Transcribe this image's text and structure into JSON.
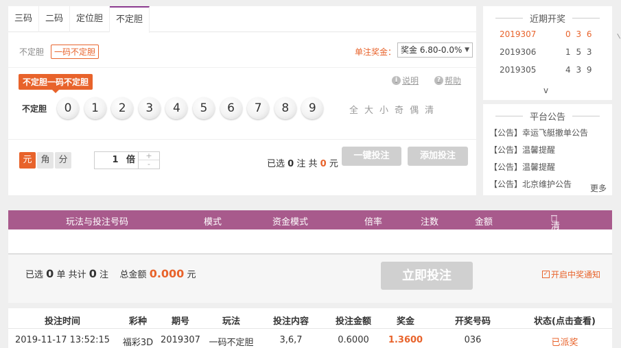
{
  "tabs": [
    "三码",
    "二码",
    "定位胆",
    "不定胆"
  ],
  "sub": {
    "plain": "不定胆",
    "active": "一码不定胆"
  },
  "prize": {
    "label": "单注奖金：",
    "select": "奖金 6.80-0.0%"
  },
  "badge": "不定胆一码不定胆",
  "help": {
    "explain": "说明",
    "help": "帮助"
  },
  "row_label": "不定胆",
  "balls": [
    "0",
    "1",
    "2",
    "3",
    "4",
    "5",
    "6",
    "7",
    "8",
    "9"
  ],
  "filters": [
    "全",
    "大",
    "小",
    "奇",
    "偶",
    "清"
  ],
  "units": [
    "元",
    "角",
    "分"
  ],
  "multiplier": {
    "value": "1",
    "unit": "倍",
    "plus": "+",
    "minus": "-"
  },
  "selection": {
    "prefix": "已选",
    "count": "0",
    "mid": "注 共",
    "amount": "0",
    "suffix": "元"
  },
  "buttons": {
    "one_click": "一键投注",
    "add": "添加投注",
    "submit": "立即投注"
  },
  "recent": {
    "title": "近期开奖",
    "draws": [
      {
        "issue": "2019307",
        "nums": "0 3 6"
      },
      {
        "issue": "2019306",
        "nums": "1 5 3"
      },
      {
        "issue": "2019305",
        "nums": "4 3 9"
      }
    ],
    "expand": "v"
  },
  "notices": {
    "title": "平台公告",
    "items": [
      "【公告】幸运飞艇撤单公告",
      "【公告】温馨提醒",
      "【公告】温馨提醒",
      "【公告】北京维护公告"
    ],
    "more": "更多"
  },
  "bet_table": {
    "headers": [
      "玩法与投注号码",
      "模式",
      "资金模式",
      "倍率",
      "注数",
      "金额",
      "清空"
    ]
  },
  "summary": {
    "p1": "已选",
    "orders": "0",
    "p2": "单 共计",
    "bets": "0",
    "p3": "注",
    "p4": "总金额",
    "total": "0.000",
    "p5": "元",
    "notify": "开启中奖通知"
  },
  "history": {
    "headers": [
      "投注时间",
      "彩种",
      "期号",
      "玩法",
      "投注内容",
      "投注金额",
      "奖金",
      "开奖号码",
      "状态(点击查看)"
    ],
    "rows": [
      [
        "2019-11-17 13:52:15",
        "福彩3D",
        "2019307",
        "一码不定胆",
        "3,6,7",
        "0.6000",
        "1.3600",
        "036",
        "已派奖"
      ]
    ]
  },
  "colors": {
    "accent": "#e8632b",
    "header": "#a85a8c",
    "tab_active": "#8b3a8f"
  }
}
